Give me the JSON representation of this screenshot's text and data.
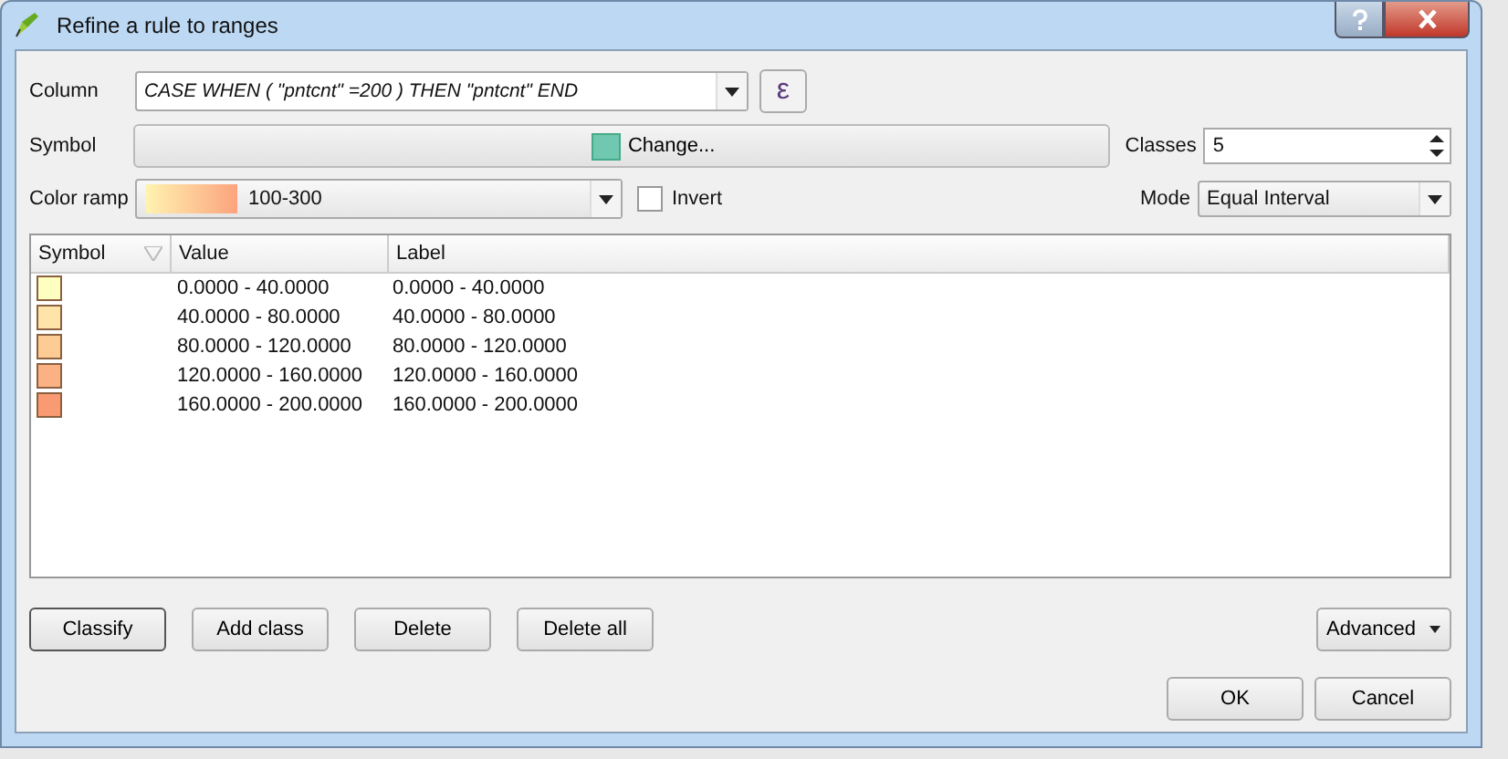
{
  "window": {
    "title": "Refine a rule to ranges"
  },
  "column": {
    "label": "Column",
    "value": "CASE WHEN (  \"pntcnt\" =200 ) THEN \"pntcnt\" END",
    "expression_button": "ε"
  },
  "symbol": {
    "label": "Symbol",
    "button": "Change...",
    "color": "#70c8b0"
  },
  "classes": {
    "label": "Classes",
    "value": "5"
  },
  "color_ramp": {
    "label": "Color ramp",
    "value": "100-300"
  },
  "invert": {
    "label": "Invert",
    "checked": false
  },
  "mode": {
    "label": "Mode",
    "value": "Equal Interval"
  },
  "table": {
    "columns": [
      "Symbol",
      "Value",
      "Label"
    ],
    "rows": [
      {
        "color": "#ffffc0",
        "value": "0.0000 - 40.0000",
        "label": "0.0000 - 40.0000"
      },
      {
        "color": "#fee4a8",
        "value": "40.0000 - 80.0000",
        "label": "40.0000 - 80.0000"
      },
      {
        "color": "#fdcb94",
        "value": "80.0000 - 120.0000",
        "label": "80.0000 - 120.0000"
      },
      {
        "color": "#fcb184",
        "value": "120.0000 - 160.0000",
        "label": "120.0000 - 160.0000"
      },
      {
        "color": "#f99a73",
        "value": "160.0000 - 200.0000",
        "label": "160.0000 - 200.0000"
      }
    ]
  },
  "actions": [
    "Classify",
    "Add class",
    "Delete",
    "Delete all"
  ],
  "advanced": "Advanced",
  "buttons": [
    "OK",
    "Cancel"
  ]
}
